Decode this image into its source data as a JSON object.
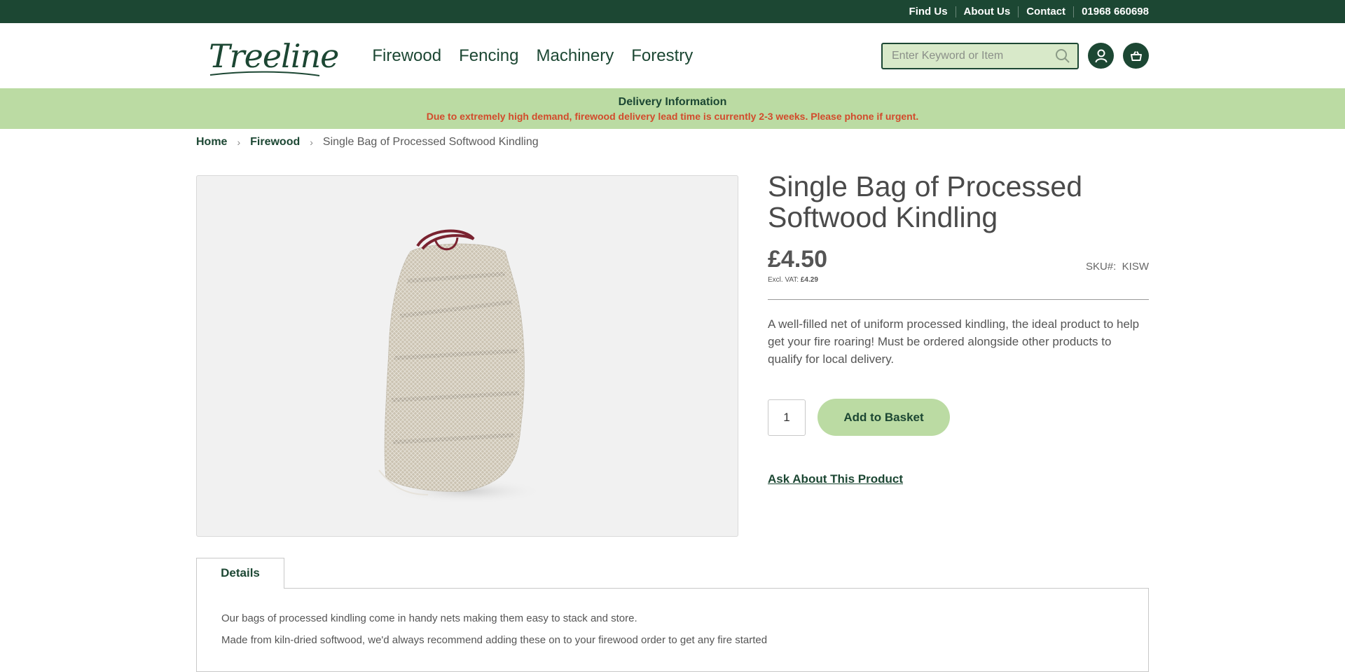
{
  "topbar": {
    "links": [
      "Find Us",
      "About Us",
      "Contact",
      "01968 660698"
    ]
  },
  "header": {
    "logo_text": "Treeline",
    "nav": [
      "Firewood",
      "Fencing",
      "Machinery",
      "Forestry"
    ],
    "search_placeholder": "Enter Keyword or Item"
  },
  "banner": {
    "title": "Delivery Information",
    "text": "Due to extremely high demand, firewood delivery lead time is currently 2-3 weeks. Please phone if urgent."
  },
  "breadcrumb": {
    "items": [
      "Home",
      "Firewood"
    ],
    "current": "Single Bag of Processed Softwood Kindling"
  },
  "product": {
    "title": "Single Bag of Processed Softwood Kindling",
    "price": "£4.50",
    "excl_label": "Excl. VAT:",
    "excl_value": "£4.29",
    "sku_label": "SKU#:",
    "sku_value": "KISW",
    "description": "A well-filled net of uniform processed kindling, the ideal product to help get your fire roaring! Must be ordered alongside other products to qualify for local delivery.",
    "quantity": "1",
    "add_button": "Add to Basket",
    "ask_link": "Ask About This Product"
  },
  "tabs": {
    "active": "Details",
    "details": [
      "Our bags of processed kindling come in handy nets making them easy to stack and store.",
      "Made from kiln-dried softwood, we'd always recommend adding these on to your firewood order to get any fire started"
    ]
  },
  "colors": {
    "brand_green": "#1c4733",
    "light_green": "#bbdba3",
    "alert_red": "#d24b2c"
  }
}
